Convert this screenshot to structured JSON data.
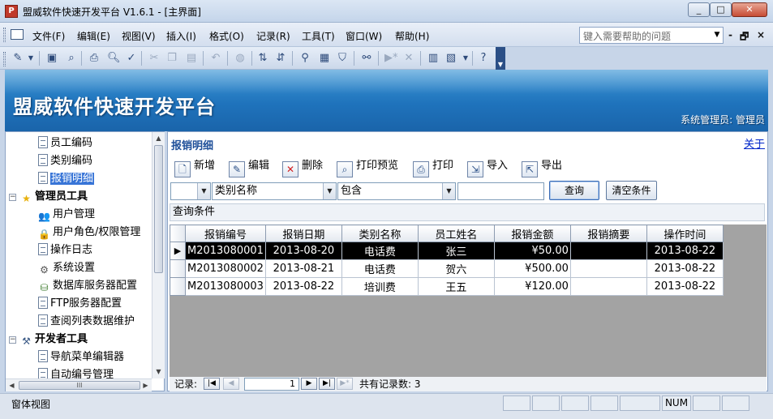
{
  "window": {
    "title": "盟威软件快速开发平台 V1.6.1 - [主界面]",
    "app_icon_glyph": "P"
  },
  "menu": {
    "items": [
      "文件(F)",
      "编辑(E)",
      "视图(V)",
      "插入(I)",
      "格式(O)",
      "记录(R)",
      "工具(T)",
      "窗口(W)",
      "帮助(H)"
    ],
    "help_placeholder": "键入需要帮助的问题",
    "mdi_min": "-",
    "mdi_restore": "🗗",
    "mdi_close": "×"
  },
  "toolbar_icons": [
    "design-view-icon",
    "save-icon",
    "file-search-icon",
    "print-icon",
    "print-preview-icon",
    "spell-check-icon",
    "cut-icon",
    "copy-icon",
    "paste-icon",
    "undo-icon",
    "hyperlink-icon",
    "sort-ascending-icon",
    "sort-descending-icon",
    "filter-by-selection-icon",
    "filter-by-form-icon",
    "apply-filter-icon",
    "find-icon",
    "new-record-icon",
    "delete-record-icon",
    "database-window-icon",
    "new-object-icon",
    "help-icon"
  ],
  "banner": {
    "title": "盟威软件快速开发平台",
    "user": "系统管理员: 管理员"
  },
  "nav": {
    "items": [
      {
        "label": "员工编码",
        "level": 1,
        "icon": "document-icon",
        "selected": false
      },
      {
        "label": "类别编码",
        "level": 1,
        "icon": "document-icon",
        "selected": false
      },
      {
        "label": "报销明细",
        "level": 1,
        "icon": "document-icon",
        "selected": true
      },
      {
        "label": "管理员工具",
        "level": 0,
        "icon": "star-icon",
        "group": true
      },
      {
        "label": "用户管理",
        "level": 1,
        "icon": "users-icon",
        "selected": false
      },
      {
        "label": "用户角色/权限管理",
        "level": 1,
        "icon": "lock-icon",
        "selected": false
      },
      {
        "label": "操作日志",
        "level": 1,
        "icon": "document-icon",
        "selected": false
      },
      {
        "label": "系统设置",
        "level": 1,
        "icon": "settings-icon",
        "selected": false
      },
      {
        "label": "数据库服务器配置",
        "level": 1,
        "icon": "database-icon",
        "selected": false
      },
      {
        "label": "FTP服务器配置",
        "level": 1,
        "icon": "document-icon",
        "selected": false
      },
      {
        "label": "查阅列表数据维护",
        "level": 1,
        "icon": "document-icon",
        "selected": false
      },
      {
        "label": "开发者工具",
        "level": 0,
        "icon": "tools-icon",
        "group": true
      },
      {
        "label": "导航菜单编辑器",
        "level": 1,
        "icon": "document-icon",
        "selected": false
      },
      {
        "label": "自动编号管理",
        "level": 1,
        "icon": "document-icon",
        "selected": false
      }
    ],
    "hscroll_thumb_grip": "III"
  },
  "main": {
    "title": "报销明细",
    "close_label": "关于",
    "actions": {
      "add": "新增",
      "edit": "编辑",
      "delete": "删除",
      "preview": "打印预览",
      "print": "打印",
      "import": "导入",
      "export": "导出"
    },
    "filter": {
      "logic": "",
      "field": "类别名称",
      "operator": "包含",
      "value": ""
    },
    "query_label": "查询",
    "clear_label": "清空条件",
    "conditions_label": "查询条件",
    "table": {
      "headers": [
        "报销编号",
        "报销日期",
        "类别名称",
        "员工姓名",
        "报销金额",
        "报销摘要",
        "操作时间"
      ],
      "rows": [
        [
          "M2013080001",
          "2013-08-20",
          "电话费",
          "张三",
          "¥50.00",
          "",
          "2013-08-22"
        ],
        [
          "M2013080002",
          "2013-08-21",
          "电话费",
          "贺六",
          "¥500.00",
          "",
          "2013-08-22"
        ],
        [
          "M2013080003",
          "2013-08-22",
          "培训费",
          "王五",
          "¥120.00",
          "",
          "2013-08-22"
        ]
      ],
      "current_row": 0,
      "current_marker": "▶"
    },
    "record_nav": {
      "label": "记录:",
      "current": "1",
      "total": "共有记录数: 3"
    }
  },
  "status": {
    "text": "窗体视图",
    "num": "NUM"
  }
}
